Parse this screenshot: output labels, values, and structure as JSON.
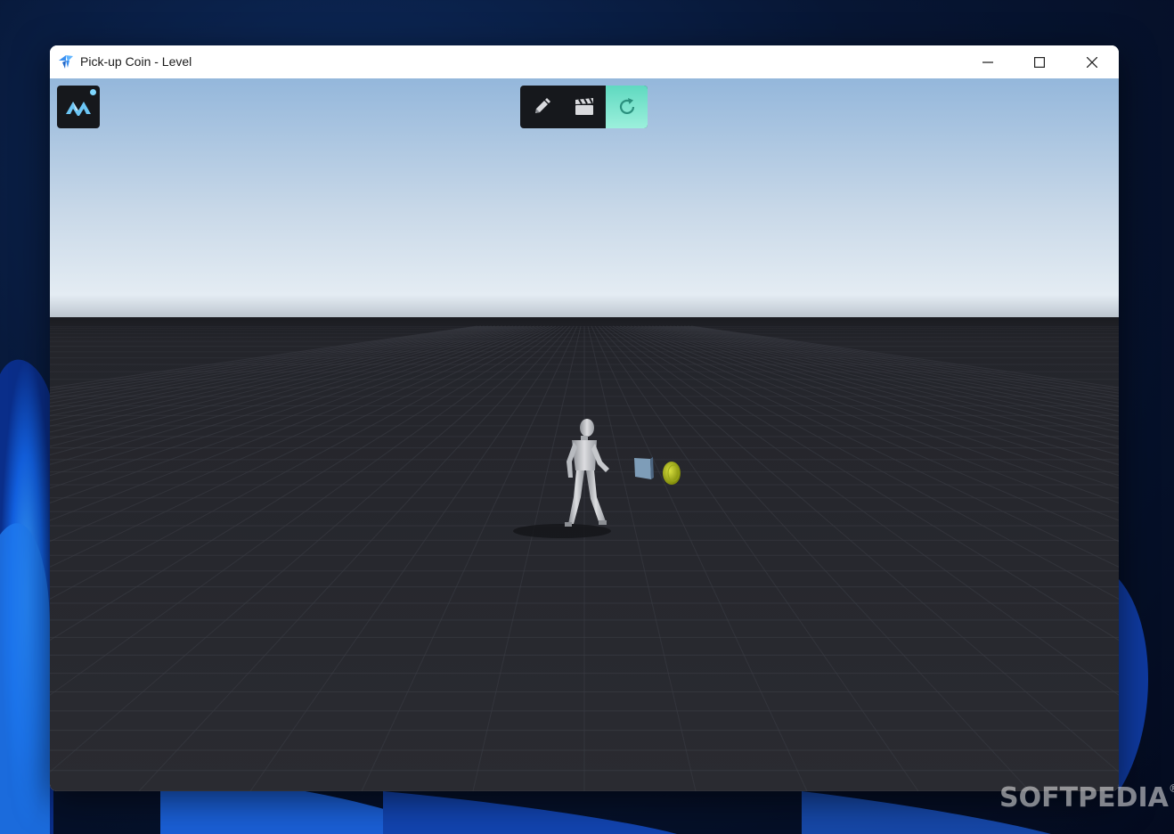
{
  "window": {
    "title": "Pick-up Coin - Level",
    "controls": {
      "minimize": "minimize-icon",
      "maximize": "maximize-icon",
      "close": "close-icon"
    }
  },
  "toolbar": {
    "tools": [
      {
        "name": "edit",
        "icon": "pencil-icon",
        "active": false
      },
      {
        "name": "cinematic",
        "icon": "clapperboard-icon",
        "active": false
      },
      {
        "name": "reset",
        "icon": "refresh-icon",
        "active": true
      }
    ],
    "active_color": "#6fe0c8"
  },
  "scene": {
    "objects": [
      "character",
      "crate",
      "coin"
    ],
    "coin_color": "#b7c41a",
    "sky_color": "#94b7db",
    "ground_color": "#25262c"
  },
  "watermark": {
    "text": "SOFTPEDIA",
    "mark": "®"
  }
}
